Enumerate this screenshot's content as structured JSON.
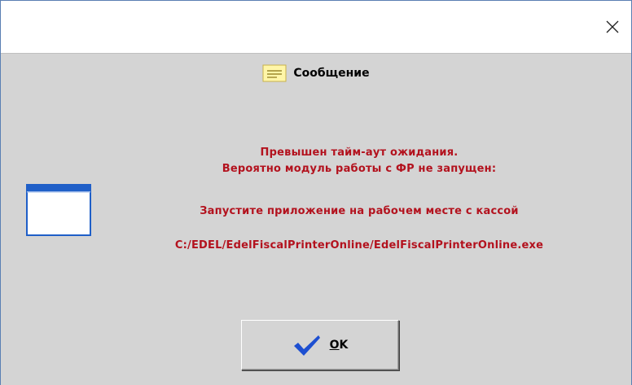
{
  "dialog": {
    "caption": "Сообщение",
    "message_lines": [
      "Превышен тайм-аут ожидания.",
      "Вероятно модуль работы с ФР не запущен:",
      "Запустите приложение на рабочем месте с кассой",
      "C:/EDEL/EdelFiscalPrinterOnline/EdelFiscalPrinterOnline.exe"
    ],
    "ok_button": {
      "underlined": "O",
      "rest": "K"
    }
  },
  "icons": {
    "close": "close-icon",
    "caption": "message-icon",
    "window": "window-icon",
    "ok": "checkmark-icon"
  },
  "colors": {
    "message_text": "#b3121e",
    "client_background": "#d4d4d4",
    "check_blue": "#1d4fd1"
  }
}
